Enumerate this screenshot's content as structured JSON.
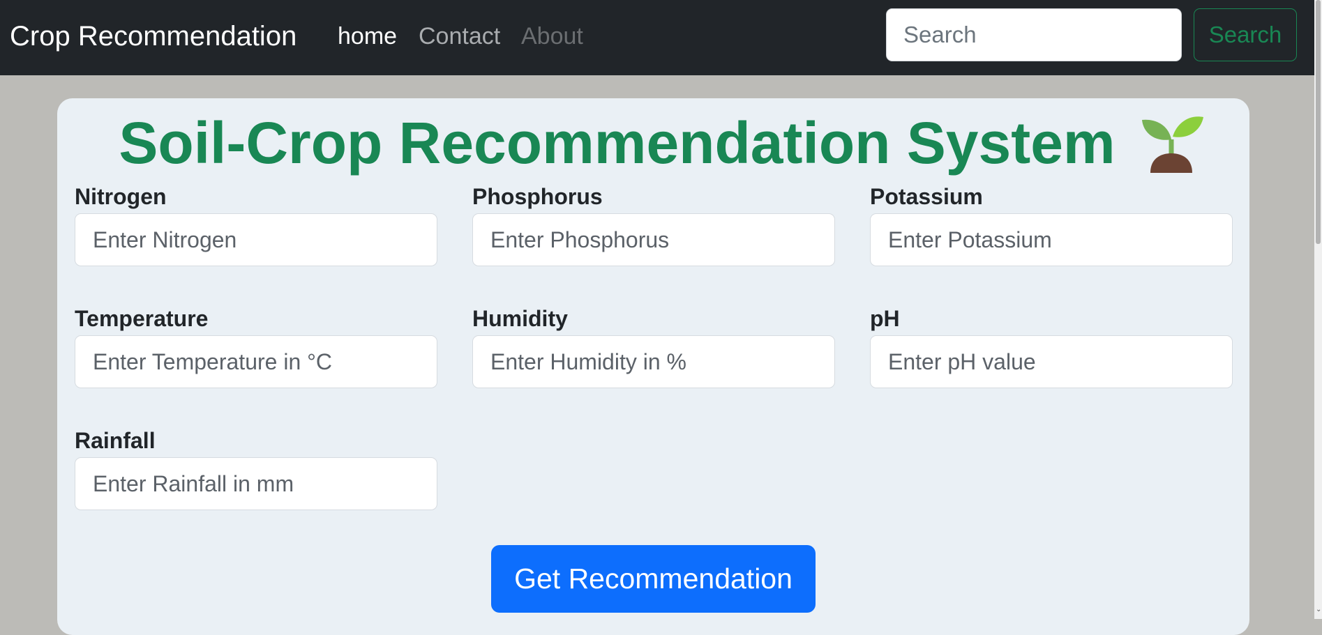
{
  "navbar": {
    "brand": "Crop Recommendation",
    "links": [
      {
        "label": "home"
      },
      {
        "label": "Contact"
      },
      {
        "label": "About"
      }
    ],
    "search": {
      "placeholder": "Search",
      "button_label": "Search"
    }
  },
  "main": {
    "title": "Soil-Crop Recommendation System",
    "title_icon": "seedling-icon",
    "fields": [
      {
        "label": "Nitrogen",
        "placeholder": "Enter Nitrogen"
      },
      {
        "label": "Phosphorus",
        "placeholder": "Enter Phosphorus"
      },
      {
        "label": "Potassium",
        "placeholder": "Enter Potassium"
      },
      {
        "label": "Temperature",
        "placeholder": "Enter Temperature in °C"
      },
      {
        "label": "Humidity",
        "placeholder": "Enter Humidity in %"
      },
      {
        "label": "pH",
        "placeholder": "Enter pH value"
      },
      {
        "label": "Rainfall",
        "placeholder": "Enter Rainfall in mm"
      }
    ],
    "submit_label": "Get Recommendation"
  },
  "colors": {
    "navbar_bg": "#212529",
    "accent_green": "#198754",
    "primary_blue": "#0d6efd",
    "card_bg": "#eaf0f5"
  }
}
